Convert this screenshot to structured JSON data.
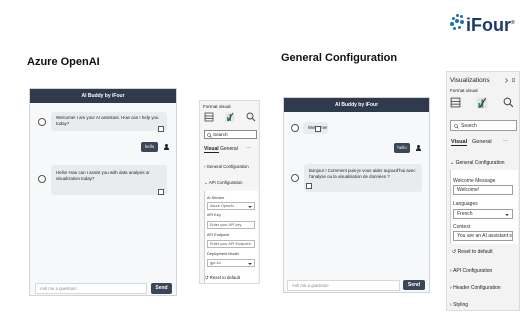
{
  "brand": {
    "logo_text": "iFour",
    "logo_trademark": "®"
  },
  "left": {
    "heading": "Azure OpenAI",
    "chat": {
      "header": "AI Buddy by iFour",
      "messages": [
        {
          "from": "bot",
          "text": "Welcome! I am your AI assistant. How can I help you today?"
        },
        {
          "from": "user",
          "text": "hello"
        },
        {
          "from": "bot",
          "text": "Hello! How can I assist you with data analysis or visualization today?"
        }
      ],
      "input_placeholder": "Ask me a question!",
      "send_label": "Send"
    },
    "pane": {
      "title": "Format visual",
      "search_placeholder": "Search",
      "tabs": [
        "Visual",
        "General"
      ],
      "more": "···",
      "sections": [
        "General Configuration",
        "API Configuration"
      ],
      "fields": [
        {
          "label": "AI Service",
          "value": "Azure OpenAI",
          "type": "select"
        },
        {
          "label": "API Key",
          "value": "Enter your API key",
          "type": "text"
        },
        {
          "label": "API Endpoint",
          "value": "Enter your API Endpoint",
          "type": "text"
        },
        {
          "label": "Deployment Model",
          "value": "gpt-4o",
          "type": "select"
        }
      ],
      "reset": "Reset to default"
    }
  },
  "right": {
    "heading": "General Configuration",
    "chat": {
      "header": "AI Buddy by iFour",
      "messages": [
        {
          "from": "bot",
          "text": "Welcome!"
        },
        {
          "from": "user",
          "text": "hello"
        },
        {
          "from": "bot",
          "text": "Bonjour ! Comment puis-je vous aider aujourd'hui avec l'analyse ou la visualisation de données ?"
        }
      ],
      "input_placeholder": "Ask me a question!",
      "send_label": "Send"
    },
    "pane": {
      "title": "Visualizations",
      "subtitle": "Format visual",
      "search_placeholder": "Search",
      "tabs": [
        "Visual",
        "General"
      ],
      "more": "···",
      "section": "General Configuration",
      "fields": [
        {
          "label": "Welcome Message",
          "value": "Welcome!",
          "type": "text"
        },
        {
          "label": "Languages",
          "value": "French",
          "type": "select"
        },
        {
          "label": "Context",
          "value": "You are an AI assistant sp",
          "type": "text"
        }
      ],
      "reset": "Reset to default",
      "collapsed": [
        "API Configuration",
        "Header Configuration",
        "Styling"
      ]
    }
  }
}
